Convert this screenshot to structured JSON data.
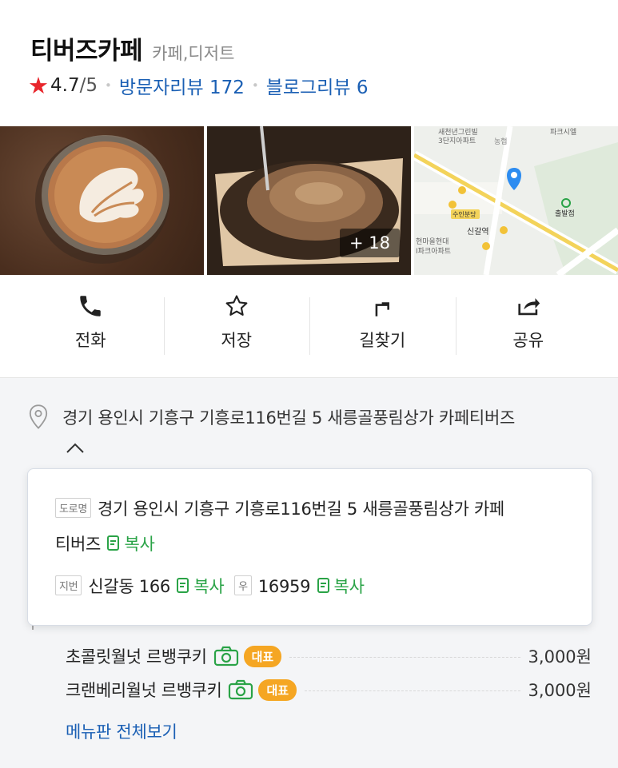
{
  "place": {
    "name": "티버즈카페",
    "category": "카페,디저트",
    "rating": "4.7",
    "rating_outof": "/5",
    "visitor_reviews": "방문자리뷰 172",
    "blog_reviews": "블로그리뷰 6"
  },
  "photos": {
    "more_count": "+ 18",
    "map_labels": {
      "apt1": "새천년그린빌",
      "apt1b": "3단지아파트",
      "bank": "농협",
      "parkcity": "파크시엘",
      "station_badge": "수인분당",
      "station": "신갈역",
      "exit": "출발점",
      "apt2": "현마을현대",
      "apt2b": "I파크아파트"
    }
  },
  "actions": [
    {
      "label": "전화",
      "icon": "phone-icon"
    },
    {
      "label": "저장",
      "icon": "star-outline-icon"
    },
    {
      "label": "길찾기",
      "icon": "directions-icon"
    },
    {
      "label": "공유",
      "icon": "share-icon"
    }
  ],
  "address": {
    "main": "경기 용인시 기흥구 기흥로116번길 5 새릉골풍림상가 카페티버즈",
    "road_tag": "도로명",
    "road_line1": "경기 용인시 기흥구 기흥로116번길 5 새릉골풍림상가 카페",
    "road_line2": "티버즈",
    "jibun_tag": "지번",
    "jibun": "신갈동 166",
    "zip_tag": "우",
    "zip": "16959",
    "copy_label": "복사"
  },
  "menu": {
    "items": [
      {
        "name": "초콜릿월넛 르뱅쿠키",
        "badge": "대표",
        "price": "3,000원"
      },
      {
        "name": "크랜베리월넛 르뱅쿠키",
        "badge": "대표",
        "price": "3,000원"
      }
    ],
    "more_label": "메뉴판 전체보기"
  },
  "colors": {
    "accent_blue": "#1a5fb4",
    "star_red": "#e8262c",
    "copy_green": "#2aa347",
    "badge_orange": "#f5a623"
  }
}
